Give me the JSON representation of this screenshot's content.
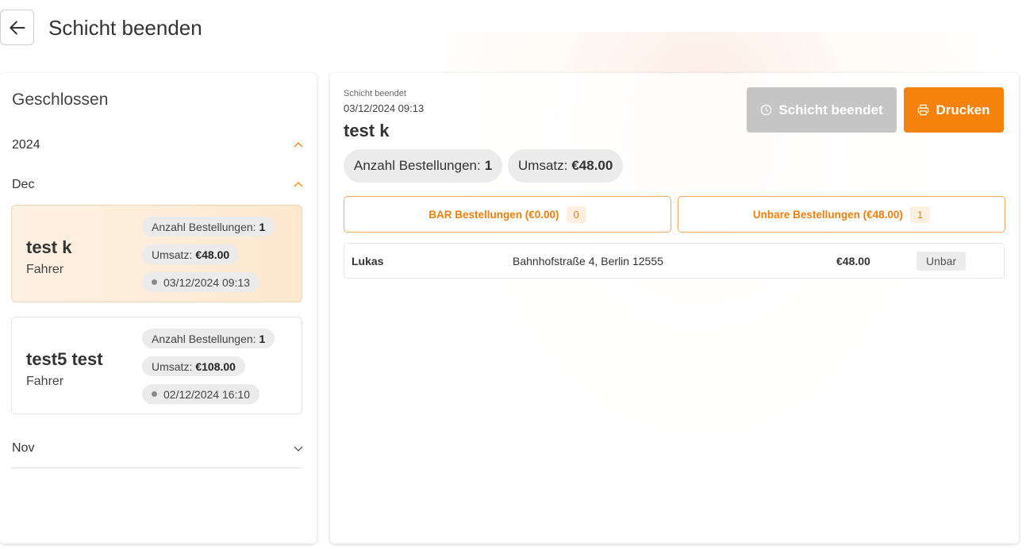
{
  "header": {
    "title": "Schicht beenden"
  },
  "left": {
    "title": "Geschlossen",
    "year": "2024",
    "months": {
      "dec": "Dec",
      "nov": "Nov"
    },
    "shifts": [
      {
        "name": "test k",
        "role": "Fahrer",
        "orders_label": "Anzahl Bestellungen:",
        "orders_value": "1",
        "revenue_label": "Umsatz:",
        "revenue_value": "€48.00",
        "date": "03/12/2024 09:13"
      },
      {
        "name": "test5 test",
        "role": "Fahrer",
        "orders_label": "Anzahl Bestellungen:",
        "orders_value": "1",
        "revenue_label": "Umsatz:",
        "revenue_value": "€108.00",
        "date": "02/12/2024 16:10"
      }
    ]
  },
  "detail": {
    "status_label": "Schicht beendet",
    "date": "03/12/2024 09:13",
    "name": "test k",
    "ended_button": "Schicht beendet",
    "print_button": "Drucken",
    "orders_label": "Anzahl Bestellungen:",
    "orders_value": "1",
    "revenue_label": "Umsatz:",
    "revenue_value": "€48.00",
    "tabs": [
      {
        "label": "BAR Bestellungen (€0.00)",
        "count": "0"
      },
      {
        "label": "Unbare Bestellungen (€48.00)",
        "count": "1"
      }
    ],
    "orders": [
      {
        "customer": "Lukas",
        "address": "Bahnhofstraße 4, Berlin 12555",
        "amount": "€48.00",
        "payment": "Unbar"
      }
    ]
  },
  "colors": {
    "accent": "#f5820c",
    "disabled": "#c5c5c5"
  },
  "icons": {
    "back": "arrow-left-icon",
    "clock": "clock-icon",
    "print": "printer-icon",
    "expand": "chevron-up-icon",
    "collapse": "chevron-down-icon"
  }
}
